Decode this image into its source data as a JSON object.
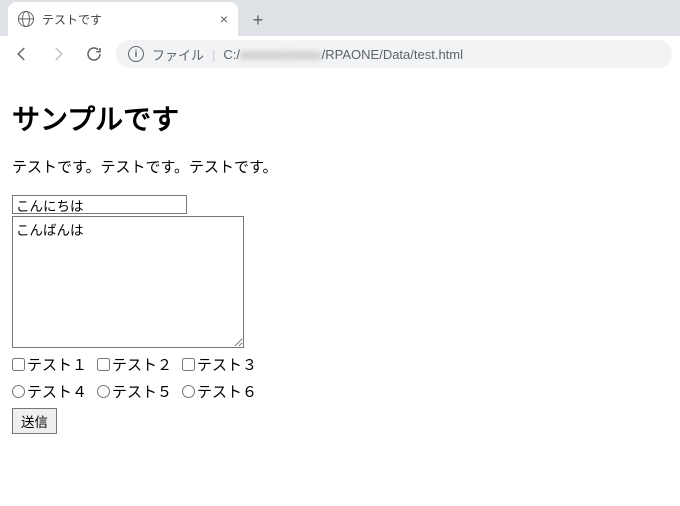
{
  "browser": {
    "tab_title": "テストです",
    "url_prefix": "ファイル",
    "url_head": "C:/",
    "url_blurred": "xxxxxxx/xxxxx",
    "url_tail": "/RPAONE/Data/test.html"
  },
  "page": {
    "heading": "サンプルです",
    "paragraph": "テストです。テストです。テストです。",
    "input_value": "こんにちは",
    "textarea_value": "こんばんは",
    "checkboxes": [
      "テスト１",
      "テスト２",
      "テスト３"
    ],
    "radios": [
      "テスト４",
      "テスト５",
      "テスト６"
    ],
    "submit_label": "送信"
  }
}
